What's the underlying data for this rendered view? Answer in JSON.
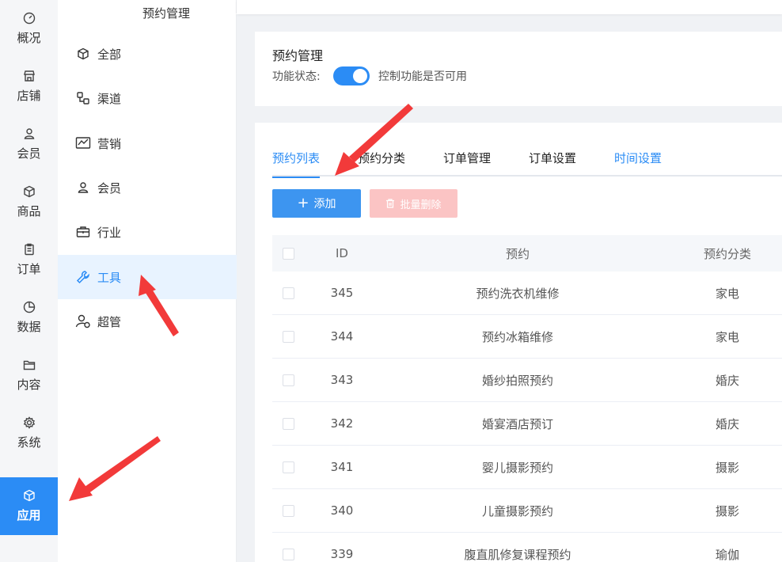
{
  "nav": {
    "items": [
      {
        "label": "概况",
        "icon": "dashboard-icon"
      },
      {
        "label": "店铺",
        "icon": "store-icon"
      },
      {
        "label": "会员",
        "icon": "user-icon"
      },
      {
        "label": "商品",
        "icon": "box-icon"
      },
      {
        "label": "订单",
        "icon": "clipboard-icon"
      },
      {
        "label": "数据",
        "icon": "pie-chart-icon"
      },
      {
        "label": "内容",
        "icon": "folder-icon"
      },
      {
        "label": "系统",
        "icon": "gear-icon"
      },
      {
        "label": "应用",
        "icon": "cube-icon"
      }
    ],
    "active": "应用"
  },
  "submenu": {
    "title": "预约管理",
    "items": [
      {
        "label": "全部",
        "icon": "cube-icon"
      },
      {
        "label": "渠道",
        "icon": "channel-icon"
      },
      {
        "label": "营销",
        "icon": "chart-icon"
      },
      {
        "label": "会员",
        "icon": "user-icon"
      },
      {
        "label": "行业",
        "icon": "briefcase-icon"
      },
      {
        "label": "工具",
        "icon": "wrench-icon"
      },
      {
        "label": "超管",
        "icon": "admin-icon"
      }
    ],
    "active": "工具"
  },
  "feature": {
    "title": "预约管理",
    "status_label": "功能状态:",
    "enabled": true,
    "description": "控制功能是否可用"
  },
  "tabs": [
    {
      "label": "预约列表"
    },
    {
      "label": "预约分类"
    },
    {
      "label": "订单管理"
    },
    {
      "label": "订单设置"
    },
    {
      "label": "时间设置"
    }
  ],
  "toolbar": {
    "add_label": "添加",
    "batch_delete_label": "批量删除"
  },
  "table": {
    "columns": [
      "ID",
      "预约",
      "预约分类"
    ],
    "rows": [
      {
        "id": "345",
        "name": "预约洗衣机维修",
        "category": "家电"
      },
      {
        "id": "344",
        "name": "预约冰箱维修",
        "category": "家电"
      },
      {
        "id": "343",
        "name": "婚纱拍照预约",
        "category": "婚庆"
      },
      {
        "id": "342",
        "name": "婚宴酒店预订",
        "category": "婚庆"
      },
      {
        "id": "341",
        "name": "婴儿摄影预约",
        "category": "摄影"
      },
      {
        "id": "340",
        "name": "儿童摄影预约",
        "category": "摄影"
      },
      {
        "id": "339",
        "name": "腹直肌修复课程预约",
        "category": "瑜伽"
      }
    ]
  },
  "colors": {
    "primary": "#2b8cf5",
    "danger_light": "#fbc4c4",
    "annotation_arrow": "#f23a3a"
  }
}
